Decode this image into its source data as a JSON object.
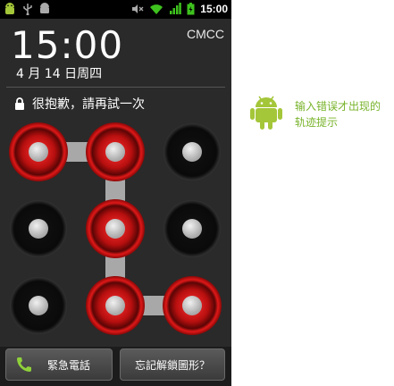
{
  "status_bar": {
    "time": "15:00"
  },
  "lockscreen": {
    "clock": "15:00",
    "carrier": "CMCC",
    "date": "4 月 14 日周四",
    "message": "很抱歉，請再試一次"
  },
  "buttons": {
    "emergency": "緊急電話",
    "forgot": "忘記解鎖圖形？"
  },
  "annotation": {
    "text": "输入错误才出现的轨迹提示"
  },
  "pattern": {
    "selected_dots": [
      1,
      2,
      5,
      8,
      9
    ],
    "path": [
      1,
      2,
      5,
      8,
      9
    ]
  },
  "colors": {
    "error_red": "#d01818",
    "android_green": "#a4c639",
    "hint_green": "#78b32a"
  }
}
